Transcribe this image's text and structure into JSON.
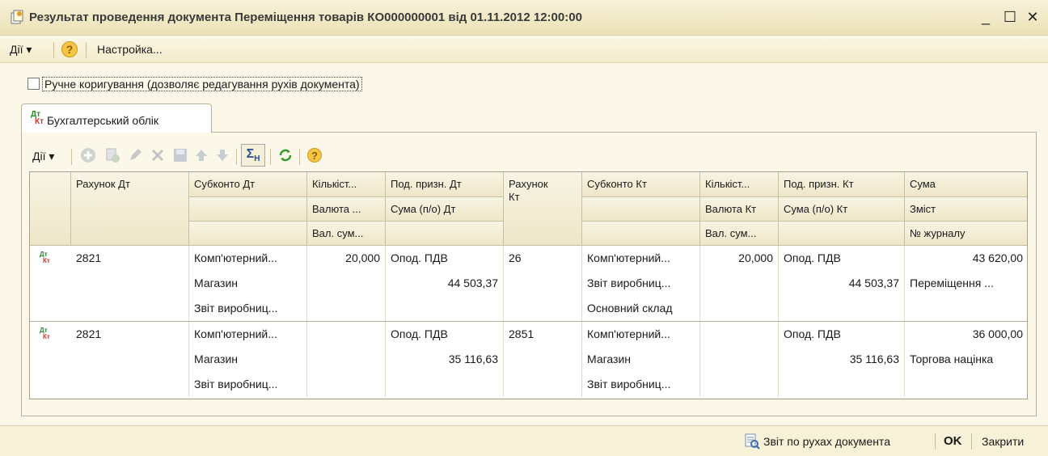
{
  "window": {
    "title": "Результат проведення документа Переміщення товарів КО000000001 від 01.11.2012 12:00:00",
    "minimize": "_",
    "maximize": "☐",
    "close": "✕"
  },
  "menubar": {
    "actions": "Дії ▾",
    "help": "?",
    "settings": "Настройка..."
  },
  "manual_edit": {
    "label": "Ручне коригування (дозволяє редагування рухів документа)",
    "checked": false
  },
  "tabs": [
    {
      "label": "Бухгалтерський облік",
      "icon": "dt-kt-icon"
    }
  ],
  "toolbar": {
    "actions": "Дії ▾",
    "icons": [
      "add-icon",
      "copy-icon",
      "edit-icon",
      "delete-icon",
      "save-icon",
      "move-up-icon",
      "move-down-icon",
      "sigma-h-icon",
      "refresh-icon",
      "help-icon"
    ]
  },
  "table": {
    "headers": {
      "rahunok_dt": "Рахунок Дт",
      "subkonto_dt": "Субконто Дт",
      "kilkist_dt": "Кількіст...",
      "valuta_dt": "Валюта ...",
      "val_sum_dt": "Вал. сум...",
      "pod_dt": "Под. призн. Дт",
      "suma_po_dt": "Сума (п/о) Дт",
      "rahunok_kt_1": "Рахунок",
      "rahunok_kt_2": "Кт",
      "subkonto_kt": "Субконто Кт",
      "kilkist_kt": "Кількіст...",
      "valuta_kt": "Валюта Кт",
      "val_sum_kt": "Вал. сум...",
      "pod_kt": "Под. призн. Кт",
      "suma_po_kt": "Сума (п/о) Кт",
      "suma": "Сума",
      "zmist": "Зміст",
      "journal": "№ журналу"
    },
    "rows": [
      {
        "rahunok_dt": "2821",
        "subkonto_dt": [
          "Комп'ютерний...",
          "Магазин",
          "Звіт виробниц..."
        ],
        "kilkist_dt": "20,000",
        "pod_dt": "Опод. ПДВ",
        "suma_po_dt": "44 503,37",
        "rahunok_kt": "26",
        "subkonto_kt": [
          "Комп'ютерний...",
          "Звіт виробниц...",
          "Основний склад"
        ],
        "kilkist_kt": "20,000",
        "pod_kt": "Опод. ПДВ",
        "suma_po_kt": "44 503,37",
        "suma": "43 620,00",
        "zmist": "Переміщення ..."
      },
      {
        "rahunok_dt": "2821",
        "subkonto_dt": [
          "Комп'ютерний...",
          "Магазин",
          "Звіт виробниц..."
        ],
        "kilkist_dt": "",
        "pod_dt": "Опод. ПДВ",
        "suma_po_dt": "35 116,63",
        "rahunok_kt": "2851",
        "subkonto_kt": [
          "Комп'ютерний...",
          "Магазин",
          "Звіт виробниц..."
        ],
        "kilkist_kt": "",
        "pod_kt": "Опод. ПДВ",
        "suma_po_kt": "35 116,63",
        "suma": "36 000,00",
        "zmist": "Торгова націнка"
      }
    ]
  },
  "footer": {
    "report": "Звіт по рухах документа",
    "ok": "OK",
    "close": "Закрити"
  },
  "colors": {
    "titlebar": "#ece1b7",
    "accent_green": "#3a9a2c",
    "dt_red": "#c0392b"
  }
}
